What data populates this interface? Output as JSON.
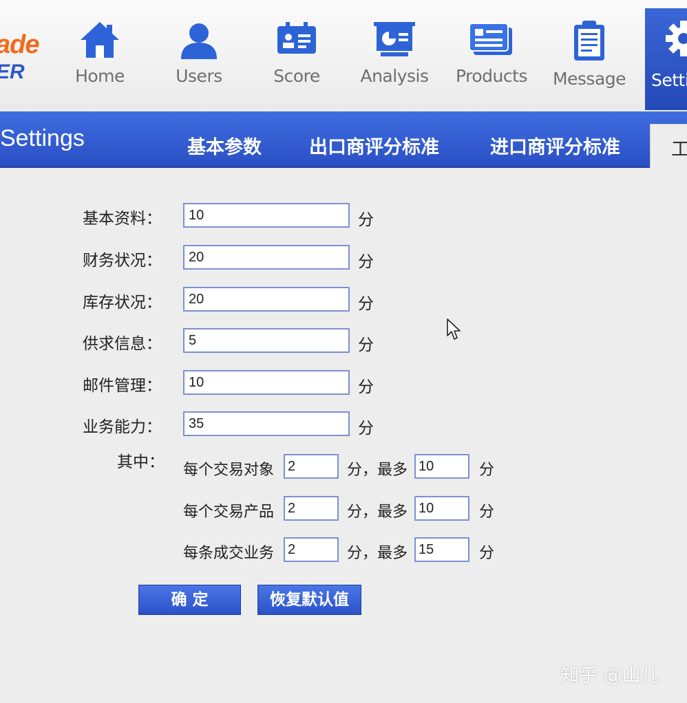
{
  "brand": {
    "line1": "ade",
    "line2": "ER"
  },
  "nav": [
    {
      "label": "Home",
      "icon": "home-icon"
    },
    {
      "label": "Users",
      "icon": "user-icon"
    },
    {
      "label": "Score",
      "icon": "score-card-icon"
    },
    {
      "label": "Analysis",
      "icon": "presentation-board-icon"
    },
    {
      "label": "Products",
      "icon": "products-icon"
    },
    {
      "label": "Message",
      "icon": "clipboard-icon"
    },
    {
      "label": "Setti",
      "icon": "gear-icon",
      "active": true
    }
  ],
  "header": {
    "title": "Settings",
    "tabs": [
      "基本参数",
      "出口商评分标准",
      "进口商评分标准"
    ],
    "active_tab_partial": "工"
  },
  "form": {
    "rows": [
      {
        "label": "基本资料：",
        "value": "10",
        "unit": "分"
      },
      {
        "label": "财务状况：",
        "value": "20",
        "unit": "分"
      },
      {
        "label": "库存状况：",
        "value": "20",
        "unit": "分"
      },
      {
        "label": "供求信息：",
        "value": "5",
        "unit": "分"
      },
      {
        "label": "邮件管理：",
        "value": "10",
        "unit": "分"
      },
      {
        "label": "业务能力：",
        "value": "35",
        "unit": "分"
      }
    ],
    "sub_label": "其中：",
    "sub_rows": [
      {
        "text": "每个交易对象",
        "value": "2",
        "mid": "分，最多",
        "max": "10",
        "unit": "分"
      },
      {
        "text": "每个交易产品",
        "value": "2",
        "mid": "分，最多",
        "max": "10",
        "unit": "分"
      },
      {
        "text": "每条成交业务",
        "value": "2",
        "mid": "分，最多",
        "max": "15",
        "unit": "分"
      }
    ]
  },
  "buttons": {
    "confirm": "确 定",
    "reset": "恢复默认值"
  },
  "watermark": "知乎 @山儿",
  "colors": {
    "accent": "#2f58c6",
    "brand_orange": "#f26a1b",
    "field_border": "#7f8fd0"
  }
}
